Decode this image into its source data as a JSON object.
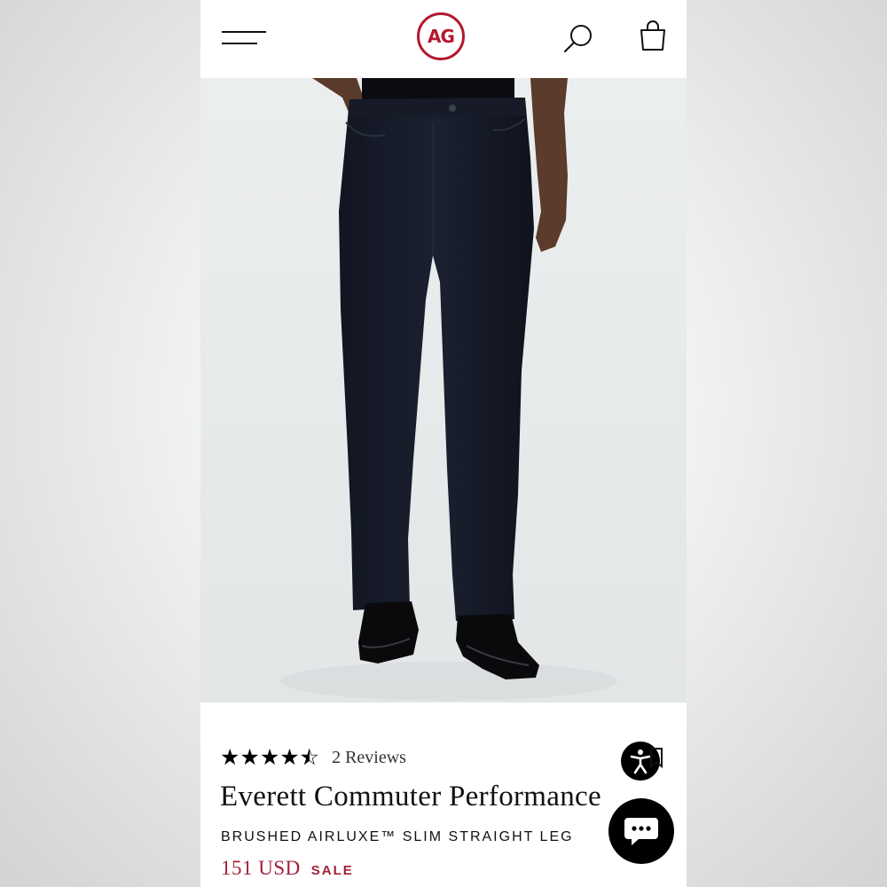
{
  "header": {
    "logo_text": "AG",
    "menu_icon": "hamburger-menu-icon",
    "search_icon": "search-icon",
    "bag_icon": "shopping-bag-icon",
    "brand_color": "#b3182f"
  },
  "product": {
    "image_alt": "Model wearing black straight leg pants with black leather boots",
    "rating": 4.5,
    "rating_max": 5,
    "reviews_label": "2 Reviews",
    "name": "Everett Commuter Performance",
    "subtitle": "BRUSHED AIRLUXE™ SLIM STRAIGHT LEG",
    "price": "151 USD",
    "sale_label": "SALE",
    "price_color": "#a3213b"
  },
  "floating": {
    "accessibility_icon": "accessibility-icon",
    "chat_icon": "chat-bubble-icon",
    "bookmark_icon": "bookmark-icon"
  }
}
